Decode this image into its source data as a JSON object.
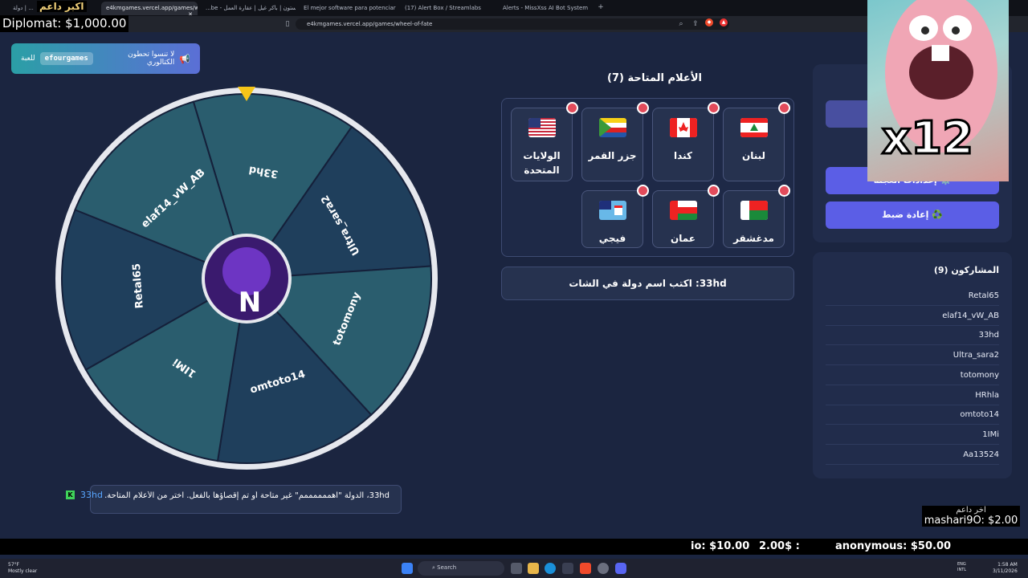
{
  "browser": {
    "tabs": [
      {
        "label": "دولة | ...",
        "active": false
      },
      {
        "label": "e4kmgames.vercel.app/games/w",
        "active": true
      },
      {
        "label": "...be - سبيستون | باكر غيل | عقارة العمل",
        "active": false
      },
      {
        "label": "El mejor software para potenciar tu",
        "active": false
      },
      {
        "label": "(17) Alert Box / Streamlabs",
        "active": false
      },
      {
        "label": "Alerts - MissXss AI Bot System",
        "active": false
      }
    ],
    "url": "e4kmgames.vercel.app/games/wheel-of-fate"
  },
  "overlay": {
    "top_title": "اكبر داعم",
    "diplomat": "Diplomat: $1,000.00",
    "banner_text": "لا تنسوا تحطون الكتالوري",
    "banner_code": "efourgames",
    "banner_suffix": "للعبة"
  },
  "wheel": {
    "segments": [
      "33hd",
      "Ultra_sara2",
      "totomony",
      "omtoto14",
      "1IMi",
      "Retal65",
      "elaf14_vW_AB"
    ],
    "center_logo": "N",
    "colors": {
      "a": "#2a5d6e",
      "b": "#1f3f5c",
      "rim": "#e6e8ee",
      "pointer": "#f5c518"
    }
  },
  "flags": {
    "title": "الأعلام المتاحة (7)",
    "items": [
      {
        "name": "لبنان",
        "icon": "lebanon-flag"
      },
      {
        "name": "كندا",
        "icon": "canada-flag"
      },
      {
        "name": "جزر القمر",
        "icon": "comoros-flag"
      },
      {
        "name": "الولايات المتحدة",
        "icon": "usa-flag"
      },
      {
        "name": "مدغشقر",
        "icon": "madagascar-flag"
      },
      {
        "name": "عمان",
        "icon": "oman-flag"
      },
      {
        "name": "فيجي",
        "icon": "fiji-flag"
      }
    ]
  },
  "prompt": "33hd: اكتب اسم دولة في الشات",
  "controls": {
    "wheel_settings": "⚙️ إعدادات العجلة",
    "reset": "♻️ إعادة ضبط"
  },
  "participants": {
    "title": "المشاركون (9)",
    "list": [
      "Retal65",
      "elaf14_vW_AB",
      "33hd",
      "Ultra_sara2",
      "totomony",
      "HRhla",
      "omtoto14",
      "1IMi",
      "Aa13524"
    ]
  },
  "webcam": {
    "overlay_text": "x12"
  },
  "chat": {
    "user": "33hd",
    "message": "33hd، الدولة \"اهممممممم\" غير متاحة أو تم إقصاؤها بالفعل. اختر من الأعلام المتاحة."
  },
  "last_supporter": {
    "label": "اخر داعم",
    "value": "mashari9O: $2.00"
  },
  "ticker": [
    {
      "text": "io: $10.00",
      "color": "#ffffff"
    },
    {
      "text": "2.00$ :",
      "color": "#ffffff"
    },
    {
      "text": "anonymous: $50.00",
      "color": "#ffffff"
    }
  ],
  "taskbar": {
    "search": "Search",
    "weather_temp": "57°F",
    "weather_desc": "Mostly clear",
    "lang1": "ENG",
    "lang2": "INTL",
    "time": "1:58 AM",
    "date": "3/11/2026"
  }
}
